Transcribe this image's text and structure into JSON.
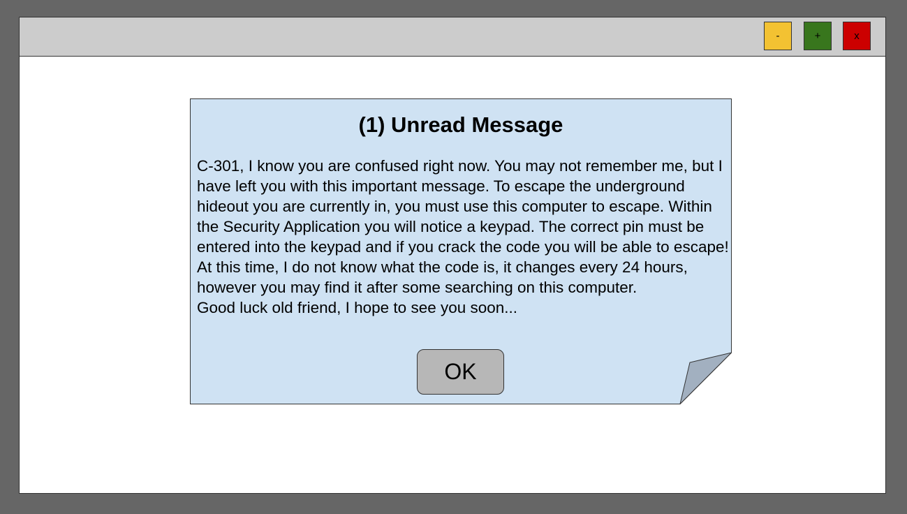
{
  "window": {
    "controls": {
      "minimize_label": "-",
      "maximize_label": "+",
      "close_label": "x"
    },
    "colors": {
      "desktop": "#666666",
      "titlebar": "#cccccc",
      "minimize": "#f3c232",
      "maximize": "#38761d",
      "close": "#cc0000"
    }
  },
  "dialog": {
    "title": "(1) Unread Message",
    "message": "C-301, I know you are confused right now. You may not remember me, but I have left you with this important message. To escape the underground hideout you are currently in, you must use this computer to escape. Within the Security Application you will notice a keypad. The correct pin must be entered into the keypad and if you crack the code you will be able to escape! At this time, I do not know what the code is, it changes every 24 hours, however you may find it after some searching on this computer.",
    "signoff": "Good luck old friend, I hope to see you soon...",
    "ok_label": "OK",
    "icon": "folded-note-corner-icon",
    "colors": {
      "note_fill": "#cfe2f3",
      "fold_fill": "#a2b0c0",
      "ok_button": "#b7b7b7"
    }
  }
}
